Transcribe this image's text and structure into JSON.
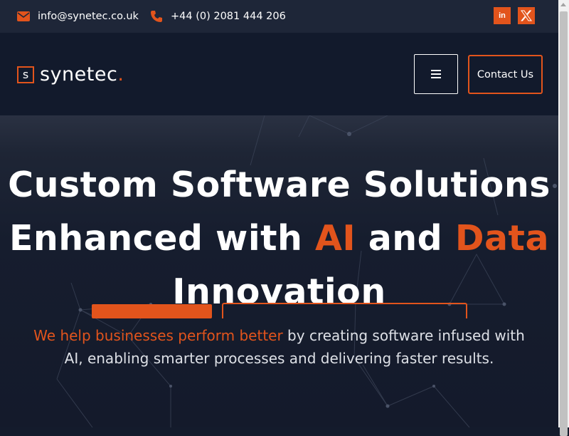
{
  "topbar": {
    "email": "info@synetec.co.uk",
    "phone": "+44 (0) 2081 444 206",
    "social": [
      {
        "name": "linkedin-icon",
        "label": "in"
      },
      {
        "name": "x-twitter-icon",
        "label": ""
      }
    ]
  },
  "header": {
    "logo_mark": "s",
    "logo_text": "synetec",
    "logo_dot": ".",
    "contact_label": "Contact Us",
    "menu_icon": "hamburger-menu-icon"
  },
  "hero": {
    "line1": "Custom Software Solutions",
    "line2_a": "Enhanced with ",
    "line2_b": "AI",
    "line2_c": " and ",
    "line2_d": "Data",
    "line3": "Innovation",
    "sub_accent": "We help businesses perform better",
    "sub_rest": " by creating software infused with AI, enabling smarter processes and delivering faster results."
  },
  "colors": {
    "accent": "#e2541c",
    "topbar_bg": "#1e2638",
    "header_bg": "#121a2c",
    "hero_bg": "#141a2b"
  }
}
